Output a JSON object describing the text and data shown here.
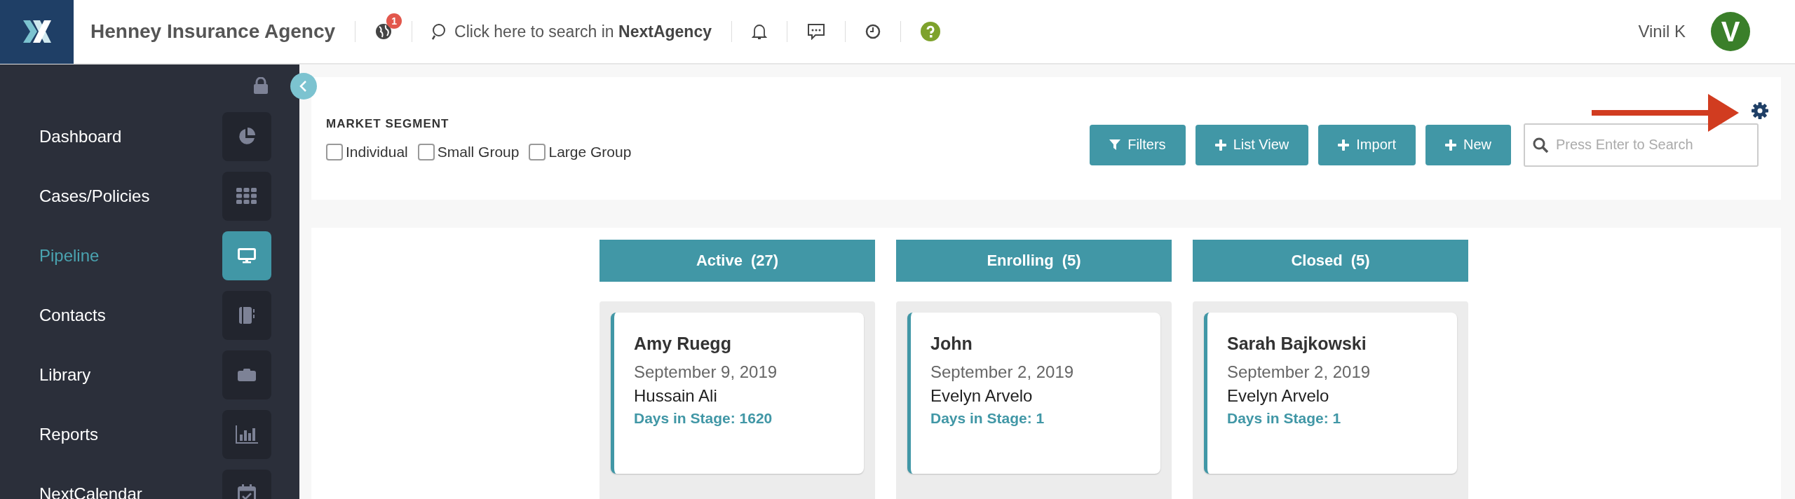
{
  "header": {
    "app_name": "Henney Insurance Agency",
    "notification_badge": "1",
    "search_prompt": "Click here to search in **NextAgency**",
    "user_name": "Vinil K",
    "avatar_initial": "V"
  },
  "sidebar": {
    "items": [
      {
        "label": "Dashboard",
        "kind": "pie",
        "selected": false
      },
      {
        "label": "Cases/Policies",
        "kind": "grid",
        "selected": false
      },
      {
        "label": "Pipeline",
        "kind": "monitor",
        "selected": true
      },
      {
        "label": "Contacts",
        "kind": "book",
        "selected": false
      },
      {
        "label": "Library",
        "kind": "briefcase",
        "selected": false
      },
      {
        "label": "Reports",
        "kind": "bars",
        "selected": false
      },
      {
        "label": "NextCalendar",
        "kind": "calendar",
        "selected": false
      }
    ]
  },
  "filters": {
    "title": "MARKET SEGMENT",
    "options": [
      {
        "label": "Individual",
        "checked": false
      },
      {
        "label": "Small Group",
        "checked": false
      },
      {
        "label": "Large Group",
        "checked": false
      }
    ],
    "buttons": [
      {
        "label": "Filters",
        "kind": "filter"
      },
      {
        "label": "List View",
        "kind": "plus"
      },
      {
        "label": "Import",
        "kind": "plus"
      },
      {
        "label": "New",
        "kind": "plus"
      }
    ],
    "search": {
      "placeholder": "Press Enter to Search"
    }
  },
  "pipeline": {
    "columns": [
      {
        "name": "Active",
        "count": "(27)",
        "cards": [
          {
            "name": "Amy Ruegg",
            "date": "September 9, 2019",
            "agent": "Hussain Ali",
            "days": "Days in Stage: 1620"
          }
        ]
      },
      {
        "name": "Enrolling",
        "count": "(5)",
        "cards": [
          {
            "name": "John",
            "date": "September 2, 2019",
            "agent": "Evelyn Arvelo",
            "days": "Days in Stage: 1"
          }
        ]
      },
      {
        "name": "Closed",
        "count": "(5)",
        "cards": [
          {
            "name": "Sarah Bajkowski",
            "date": "September 2, 2019",
            "agent": "Evelyn Arvelo",
            "days": "Days in Stage: 1"
          }
        ]
      }
    ]
  }
}
